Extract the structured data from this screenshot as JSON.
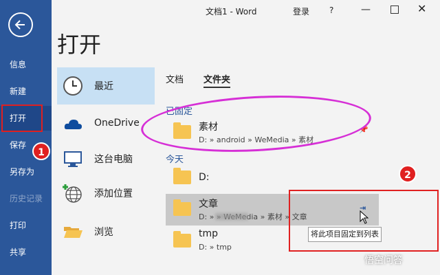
{
  "window": {
    "title": "文档1 - Word",
    "login": "登录",
    "help": "?"
  },
  "sidebar": {
    "items": [
      {
        "label": "信息"
      },
      {
        "label": "新建"
      },
      {
        "label": "打开"
      },
      {
        "label": "保存"
      },
      {
        "label": "另存为"
      },
      {
        "label": "历史记录"
      },
      {
        "label": "打印"
      },
      {
        "label": "共享"
      }
    ]
  },
  "page_title": "打开",
  "places": [
    {
      "label": "最近",
      "icon": "clock-icon"
    },
    {
      "label": "OneDrive",
      "icon": "cloud-icon"
    },
    {
      "label": "这台电脑",
      "icon": "computer-icon"
    },
    {
      "label": "添加位置",
      "icon": "globe-add-icon"
    },
    {
      "label": "浏览",
      "icon": "folder-open-icon"
    }
  ],
  "tabs": [
    {
      "label": "文档"
    },
    {
      "label": "文件夹"
    }
  ],
  "pinned_header": "已固定",
  "today_header": "今天",
  "pinned": [
    {
      "name": "素材",
      "path": "D: » android » WeMedia » 素材"
    }
  ],
  "today": [
    {
      "name": "D:",
      "path": ""
    },
    {
      "name": "文章",
      "path": "D: »         » WeMedia » 素材 » 文章"
    },
    {
      "name": "tmp",
      "path": "D: » tmp"
    }
  ],
  "tooltip": "将此项目固定到列表",
  "annotations": {
    "badge1": "1",
    "badge2": "2"
  },
  "watermark": "悟空问答",
  "colors": {
    "sidebar": "#2b579a",
    "accent_annotation": "#e02020",
    "highlight_ellipse": "#d62fd6"
  }
}
